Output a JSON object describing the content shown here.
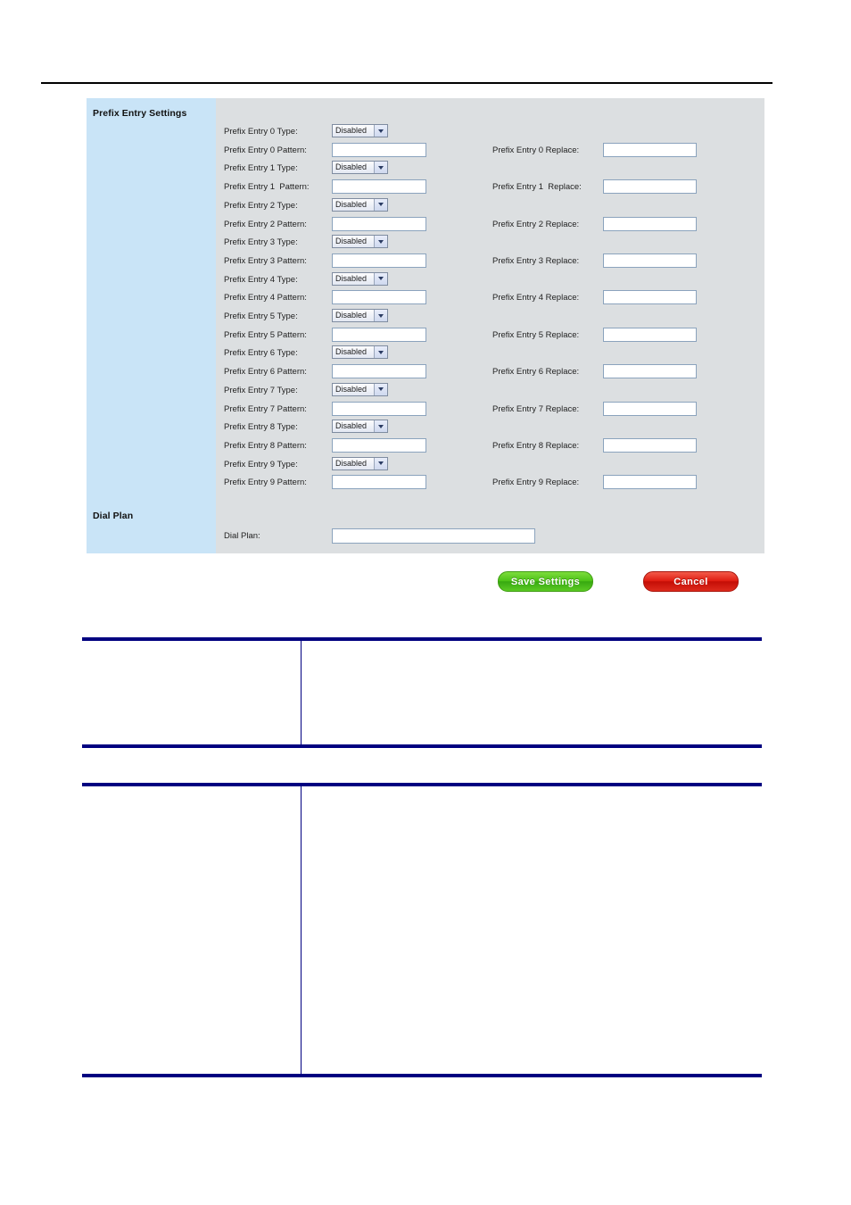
{
  "panel": {
    "section_titles": {
      "prefix_entry_settings": "Prefix Entry Settings",
      "dial_plan": "Dial Plan"
    },
    "select_default_value": "Disabled",
    "dial_plan_label": "Dial Plan:",
    "dial_plan_value": "",
    "entries": [
      {
        "type_label": "Prefix Entry 0 Type:",
        "type_value": "Disabled",
        "pattern_label": "Prefix Entry 0 Pattern:",
        "pattern_value": "",
        "replace_label": "Prefix Entry 0 Replace:",
        "replace_value": ""
      },
      {
        "type_label": "Prefix Entry 1 Type:",
        "type_value": "Disabled",
        "pattern_label": "Prefix Entry 1  Pattern:",
        "pattern_value": "",
        "replace_label": "Prefix Entry 1  Replace:",
        "replace_value": ""
      },
      {
        "type_label": "Prefix Entry 2 Type:",
        "type_value": "Disabled",
        "pattern_label": "Prefix Entry 2 Pattern:",
        "pattern_value": "",
        "replace_label": "Prefix Entry 2 Replace:",
        "replace_value": ""
      },
      {
        "type_label": "Prefix Entry 3 Type:",
        "type_value": "Disabled",
        "pattern_label": "Prefix Entry 3 Pattern:",
        "pattern_value": "",
        "replace_label": "Prefix Entry 3 Replace:",
        "replace_value": ""
      },
      {
        "type_label": "Prefix Entry 4 Type:",
        "type_value": "Disabled",
        "pattern_label": "Prefix Entry 4 Pattern:",
        "pattern_value": "",
        "replace_label": "Prefix Entry 4 Replace:",
        "replace_value": ""
      },
      {
        "type_label": "Prefix Entry 5 Type:",
        "type_value": "Disabled",
        "pattern_label": "Prefix Entry 5 Pattern:",
        "pattern_value": "",
        "replace_label": "Prefix Entry 5 Replace:",
        "replace_value": ""
      },
      {
        "type_label": "Prefix Entry 6 Type:",
        "type_value": "Disabled",
        "pattern_label": "Prefix Entry 6 Pattern:",
        "pattern_value": "",
        "replace_label": "Prefix Entry 6 Replace:",
        "replace_value": ""
      },
      {
        "type_label": "Prefix Entry 7 Type:",
        "type_value": "Disabled",
        "pattern_label": "Prefix Entry 7 Pattern:",
        "pattern_value": "",
        "replace_label": "Prefix Entry 7 Replace:",
        "replace_value": ""
      },
      {
        "type_label": "Prefix Entry 8 Type:",
        "type_value": "Disabled",
        "pattern_label": "Prefix Entry 8 Pattern:",
        "pattern_value": "",
        "replace_label": "Prefix Entry 8 Replace:",
        "replace_value": ""
      },
      {
        "type_label": "Prefix Entry 9 Type:",
        "type_value": "Disabled",
        "pattern_label": "Prefix Entry 9 Pattern:",
        "pattern_value": "",
        "replace_label": "Prefix Entry 9 Replace:",
        "replace_value": ""
      }
    ]
  },
  "actions": {
    "save_label": "Save Settings",
    "cancel_label": "Cancel"
  },
  "tables": [
    {
      "rows": [
        {
          "left": "",
          "right": ""
        }
      ]
    },
    {
      "rows": [
        {
          "left": "",
          "right": ""
        }
      ]
    }
  ],
  "colors": {
    "panel_background": "#dcdfe1",
    "sidebar_background": "#c9e4f7",
    "table_rule": "#000080",
    "save_button": "#4cc216",
    "cancel_button": "#e01b10",
    "input_border": "#8ba3bd",
    "top_rule": "#000000"
  }
}
